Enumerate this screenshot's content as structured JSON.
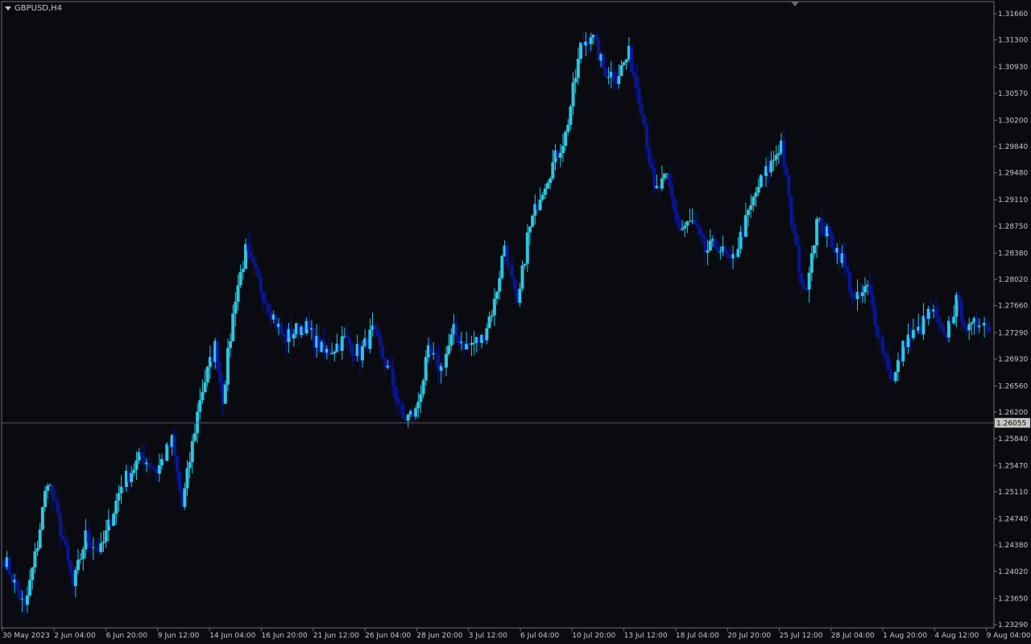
{
  "window": {
    "title": "GBPUSD,H4"
  },
  "colors": {
    "background": "#0a0b10",
    "axis": "#6f6f73",
    "text": "#c8c8c8",
    "bull": "#2ec6e0",
    "bear": "#0a1596",
    "price_line": "#5a5a60",
    "price_box_bg": "#c8c8c8",
    "price_box_text": "#0a0b10"
  },
  "icons": {
    "symbol_dropdown": "triangle-down-icon",
    "chart_shift": "triangle-down-icon"
  },
  "chart_data": {
    "type": "candlestick",
    "symbol": "GBPUSD",
    "timeframe": "H4",
    "ylim": [
      1.2329,
      1.3166
    ],
    "y_ticks": [
      "1.31660",
      "1.31300",
      "1.30930",
      "1.30570",
      "1.30200",
      "1.29840",
      "1.29480",
      "1.29110",
      "1.28750",
      "1.28380",
      "1.28020",
      "1.27660",
      "1.27290",
      "1.26930",
      "1.26560",
      "1.26200",
      "1.25840",
      "1.25470",
      "1.25110",
      "1.24740",
      "1.24380",
      "1.24020",
      "1.23650",
      "1.23290"
    ],
    "x_ticks": [
      "30 May 2023",
      "2 Jun 04:00",
      "6 Jun 20:00",
      "9 Jun 12:00",
      "14 Jun 04:00",
      "16 Jun 20:00",
      "21 Jun 12:00",
      "26 Jun 04:00",
      "28 Jun 20:00",
      "3 Jul 12:00",
      "6 Jul 04:00",
      "10 Jul 20:00",
      "13 Jul 12:00",
      "18 Jul 04:00",
      "20 Jul 20:00",
      "25 Jul 12:00",
      "28 Jul 04:00",
      "1 Aug 20:00",
      "4 Aug 12:00",
      "9 Aug 04:00"
    ],
    "current_price": "1.26055",
    "anchors": [
      [
        0,
        1.242
      ],
      [
        8,
        1.235
      ],
      [
        13,
        1.244
      ],
      [
        17,
        1.253
      ],
      [
        22,
        1.246
      ],
      [
        27,
        1.238
      ],
      [
        32,
        1.245
      ],
      [
        38,
        1.243
      ],
      [
        46,
        1.252
      ],
      [
        54,
        1.256
      ],
      [
        60,
        1.254
      ],
      [
        66,
        1.258
      ],
      [
        70,
        1.249
      ],
      [
        77,
        1.264
      ],
      [
        83,
        1.271
      ],
      [
        86,
        1.264
      ],
      [
        91,
        1.278
      ],
      [
        95,
        1.284
      ],
      [
        101,
        1.279
      ],
      [
        110,
        1.272
      ],
      [
        118,
        1.274
      ],
      [
        126,
        1.27
      ],
      [
        134,
        1.272
      ],
      [
        140,
        1.27
      ],
      [
        145,
        1.273
      ],
      [
        152,
        1.267
      ],
      [
        157,
        1.261
      ],
      [
        162,
        1.262
      ],
      [
        167,
        1.27
      ],
      [
        172,
        1.268
      ],
      [
        177,
        1.273
      ],
      [
        182,
        1.271
      ],
      [
        188,
        1.272
      ],
      [
        193,
        1.277
      ],
      [
        197,
        1.285
      ],
      [
        202,
        1.276
      ],
      [
        206,
        1.286
      ],
      [
        211,
        1.292
      ],
      [
        216,
        1.296
      ],
      [
        221,
        1.3
      ],
      [
        227,
        1.312
      ],
      [
        231,
        1.314
      ],
      [
        236,
        1.309
      ],
      [
        241,
        1.308
      ],
      [
        246,
        1.311
      ],
      [
        251,
        1.304
      ],
      [
        256,
        1.292
      ],
      [
        261,
        1.294
      ],
      [
        266,
        1.287
      ],
      [
        271,
        1.288
      ],
      [
        276,
        1.284
      ],
      [
        281,
        1.285
      ],
      [
        286,
        1.282
      ],
      [
        292,
        1.288
      ],
      [
        297,
        1.293
      ],
      [
        302,
        1.296
      ],
      [
        306,
        1.299
      ],
      [
        310,
        1.288
      ],
      [
        315,
        1.278
      ],
      [
        320,
        1.288
      ],
      [
        325,
        1.286
      ],
      [
        330,
        1.283
      ],
      [
        335,
        1.277
      ],
      [
        340,
        1.279
      ],
      [
        345,
        1.272
      ],
      [
        350,
        1.266
      ],
      [
        355,
        1.272
      ],
      [
        360,
        1.273
      ],
      [
        365,
        1.276
      ],
      [
        370,
        1.272
      ],
      [
        375,
        1.277
      ],
      [
        380,
        1.273
      ],
      [
        385,
        1.275
      ],
      [
        388,
        1.273
      ]
    ]
  }
}
